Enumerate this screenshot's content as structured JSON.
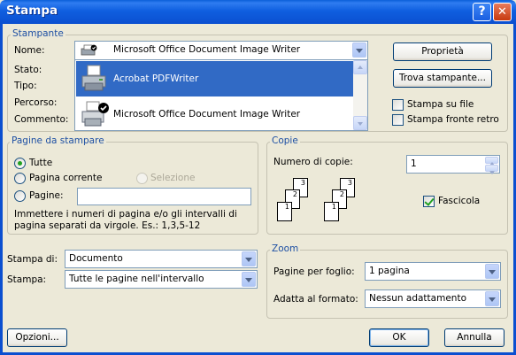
{
  "window": {
    "title": "Stampa",
    "help": "?",
    "close": "✕"
  },
  "printer": {
    "legend": "Stampante",
    "name_label": "Nome:",
    "name_value": "Microsoft Office Document Image Writer",
    "status_label": "Stato:",
    "type_label": "Tipo:",
    "path_label": "Percorso:",
    "comment_label": "Commento:",
    "list": [
      {
        "label": "Acrobat PDFWriter",
        "selected": true,
        "icon": "printer-icon"
      },
      {
        "label": "Microsoft Office Document Image Writer",
        "selected": false,
        "icon": "default-printer-icon"
      }
    ],
    "properties_btn": "Proprietà",
    "find_btn": "Trova stampante...",
    "print_to_file": "Stampa su file",
    "print_to_file_checked": false,
    "duplex": "Stampa fronte retro",
    "duplex_checked": false
  },
  "pages": {
    "legend": "Pagine da stampare",
    "all": "Tutte",
    "current": "Pagina corrente",
    "selection": "Selezione",
    "pages": "Pagine:",
    "pages_value": "",
    "hint": "Immettere i numeri di pagina e/o gli intervalli di pagina separati da virgole. Es.: 1,3,5-12",
    "selected_option": "all"
  },
  "copies": {
    "legend": "Copie",
    "count_label": "Numero di copie:",
    "count_value": "1",
    "collate": "Fascicola",
    "collate_checked": true,
    "stack_a": [
      "3",
      "2",
      "1"
    ],
    "stack_b": [
      "3",
      "2",
      "1"
    ]
  },
  "print_what": {
    "label": "Stampa di:",
    "value": "Documento",
    "print_label": "Stampa:",
    "print_value": "Tutte le pagine nell'intervallo"
  },
  "zoom": {
    "legend": "Zoom",
    "pages_per_sheet_label": "Pagine per foglio:",
    "pages_per_sheet_value": "1 pagina",
    "scale_label": "Adatta al formato:",
    "scale_value": "Nessun adattamento"
  },
  "footer": {
    "options": "Opzioni...",
    "ok": "OK",
    "cancel": "Annulla"
  },
  "colors": {
    "titlebar": "#0b4fd0",
    "legend": "#1d4fa3",
    "selection": "#316ac5",
    "face": "#ece9d8"
  }
}
